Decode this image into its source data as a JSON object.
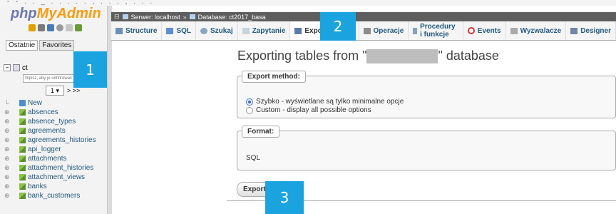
{
  "top_strip": "- - . . _ . . . . . , . . , , . . .",
  "sidebar": {
    "logo": {
      "part1": "php",
      "part2": "MyAdmin"
    },
    "tabs": [
      "Ostatnie",
      "Favorites"
    ],
    "db_name": "ct",
    "filter_placeholder": "Wpisz, aby je odfiltrować",
    "pager": {
      "page": "1",
      "next": "> >>"
    },
    "tables": [
      "New",
      "absences",
      "absence_types",
      "agreements",
      "agreements_histories",
      "api_logger",
      "attachments",
      "attachment_histories",
      "attachment_views",
      "banks",
      "bank_customers"
    ]
  },
  "breadcrumb": {
    "server": "Serwer: localhost",
    "sep": "»",
    "database": "Database: ct2017_basa"
  },
  "tabs": [
    {
      "label": "Structure",
      "color": "#6d8fb3"
    },
    {
      "label": "SQL",
      "color": "#5c8fd6"
    },
    {
      "label": "Szukaj",
      "color": "#8aa5c3"
    },
    {
      "label": "Zapytanie",
      "color": "#c8d3df"
    },
    {
      "label": "Export",
      "color": "#5b7aa8"
    },
    {
      "label": "Operacje",
      "color": "#8d8d8d"
    },
    {
      "label": "Procedury i funkcje",
      "color": "#8aa1b8"
    },
    {
      "label": "Events",
      "color": "#d33"
    },
    {
      "label": "Wyzwalacze",
      "color": "#aaa"
    },
    {
      "label": "Designer",
      "color": "#6e86a8"
    }
  ],
  "main": {
    "title_prefix": "Exporting tables from \"",
    "title_suffix": "\" database",
    "method_legend": "Export method:",
    "method_quick": "Szybko - wyświetlane są tylko minimalne opcje",
    "method_custom": "Custom - display all possible options",
    "format_legend": "Format:",
    "format_value": "SQL",
    "export_button": "Export"
  },
  "overlays": [
    "1",
    "2",
    "3"
  ],
  "colors": {
    "overlay": "#1aa3df",
    "link": "#235a81"
  }
}
